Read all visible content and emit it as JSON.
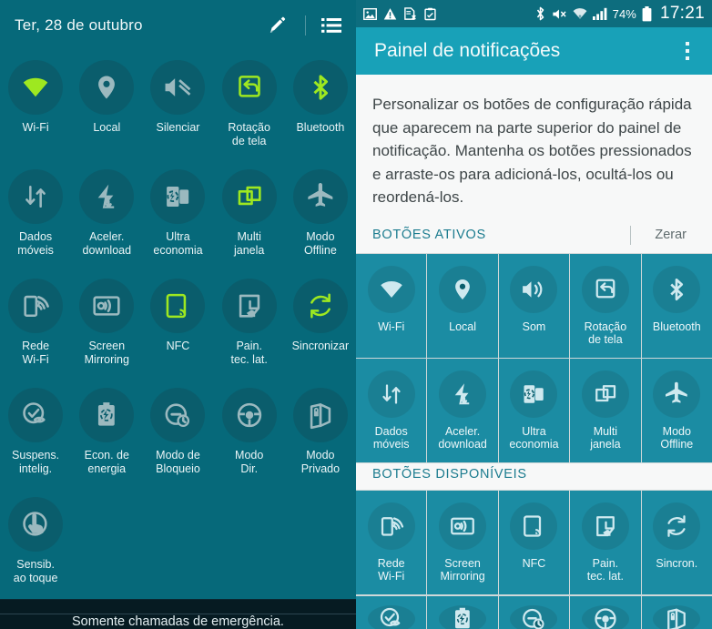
{
  "left_panel": {
    "header": {
      "date": "Ter, 28 de outubro",
      "edit_icon": "pencil-icon",
      "list_icon": "list-icon"
    },
    "toggles": [
      {
        "label": "Wi-Fi",
        "icon": "wifi-icon",
        "active": true
      },
      {
        "label": "Local",
        "icon": "location-pin-icon",
        "active": false
      },
      {
        "label": "Silenciar",
        "icon": "mute-icon",
        "active": false
      },
      {
        "label": "Rotação\nde tela",
        "icon": "screen-rotation-icon",
        "active": true
      },
      {
        "label": "Bluetooth",
        "icon": "bluetooth-icon",
        "active": true
      },
      {
        "label": "Dados\nmóveis",
        "icon": "mobile-data-icon",
        "active": false
      },
      {
        "label": "Aceler.\ndownload",
        "icon": "download-booster-icon",
        "active": false
      },
      {
        "label": "Ultra\neconomia",
        "icon": "ultra-power-saving-icon",
        "active": false
      },
      {
        "label": "Multi\njanela",
        "icon": "multi-window-icon",
        "active": true
      },
      {
        "label": "Modo\nOffline",
        "icon": "airplane-mode-icon",
        "active": false
      },
      {
        "label": "Rede\nWi-Fi",
        "icon": "wifi-hotspot-icon",
        "active": false
      },
      {
        "label": "Screen\nMirroring",
        "icon": "screen-mirroring-icon",
        "active": false
      },
      {
        "label": "NFC",
        "icon": "nfc-icon",
        "active": true
      },
      {
        "label": "Pain.\ntec. lat.",
        "icon": "side-key-panel-icon",
        "active": false
      },
      {
        "label": "Sincronizar",
        "icon": "sync-icon",
        "active": true
      },
      {
        "label": "Suspens.\nintelig.",
        "icon": "smart-stay-icon",
        "active": false
      },
      {
        "label": "Econ. de\nenergia",
        "icon": "power-saving-icon",
        "active": false
      },
      {
        "label": "Modo de\nBloqueio",
        "icon": "blocking-mode-icon",
        "active": false
      },
      {
        "label": "Modo\nDir.",
        "icon": "driving-mode-icon",
        "active": false
      },
      {
        "label": "Modo\nPrivado",
        "icon": "private-mode-icon",
        "active": false
      },
      {
        "label": "Sensib.\nao toque",
        "icon": "touch-sensitivity-icon",
        "active": false
      }
    ],
    "emergency_text": "Somente chamadas de emergência."
  },
  "right_panel": {
    "status_bar": {
      "left_icons": [
        "image-icon",
        "warning-triangle-icon",
        "document-x-icon",
        "clipboard-icon"
      ],
      "right_icons": [
        "bluetooth-icon",
        "mute-icon",
        "wifi-icon",
        "signal-bars-icon",
        "battery-icon"
      ],
      "battery_percent": "74%",
      "time": "17:21"
    },
    "app_bar": {
      "title": "Painel de notificações",
      "overflow_icon": "more-vertical-icon"
    },
    "description": "Personalizar os botões de configuração rápida que aparecem na parte superior do painel de notificação. Mantenha os botões pressionados e arraste-os para adicioná-los, ocultá-los ou reordená-los.",
    "active_section": {
      "title": "BOTÕES ATIVOS",
      "action": "Zerar",
      "buttons": [
        {
          "label": "Wi-Fi",
          "icon": "wifi-icon"
        },
        {
          "label": "Local",
          "icon": "location-pin-icon"
        },
        {
          "label": "Som",
          "icon": "sound-icon"
        },
        {
          "label": "Rotação\nde tela",
          "icon": "screen-rotation-icon"
        },
        {
          "label": "Bluetooth",
          "icon": "bluetooth-icon"
        },
        {
          "label": "Dados\nmóveis",
          "icon": "mobile-data-icon"
        },
        {
          "label": "Aceler.\ndownload",
          "icon": "download-booster-icon"
        },
        {
          "label": "Ultra\neconomia",
          "icon": "ultra-power-saving-icon"
        },
        {
          "label": "Multi\njanela",
          "icon": "multi-window-icon"
        },
        {
          "label": "Modo\nOffline",
          "icon": "airplane-mode-icon"
        }
      ]
    },
    "available_section": {
      "title": "BOTÕES DISPONÍVEIS",
      "buttons": [
        {
          "label": "Rede\nWi-Fi",
          "icon": "wifi-hotspot-icon"
        },
        {
          "label": "Screen\nMirroring",
          "icon": "screen-mirroring-icon"
        },
        {
          "label": "NFC",
          "icon": "nfc-icon"
        },
        {
          "label": "Pain.\ntec. lat.",
          "icon": "side-key-panel-icon"
        },
        {
          "label": "Sincron.",
          "icon": "sync-icon"
        }
      ],
      "partial_row": [
        {
          "label": "",
          "icon": "smart-stay-icon"
        },
        {
          "label": "",
          "icon": "power-saving-icon"
        },
        {
          "label": "",
          "icon": "blocking-mode-icon"
        },
        {
          "label": "",
          "icon": "driving-mode-icon"
        },
        {
          "label": "",
          "icon": "private-mode-icon"
        }
      ]
    }
  },
  "colors": {
    "left_bg": "#06697a",
    "left_circle": "#0a5d6c",
    "active_green": "#9ee820",
    "inactive_gray": "#9bb9bf",
    "right_tile": "#1b8ca3",
    "right_circle": "#1a7f93",
    "appbar": "#18a1b8",
    "statusbar": "#0d6d7e",
    "section_title": "#1c7c8f"
  }
}
